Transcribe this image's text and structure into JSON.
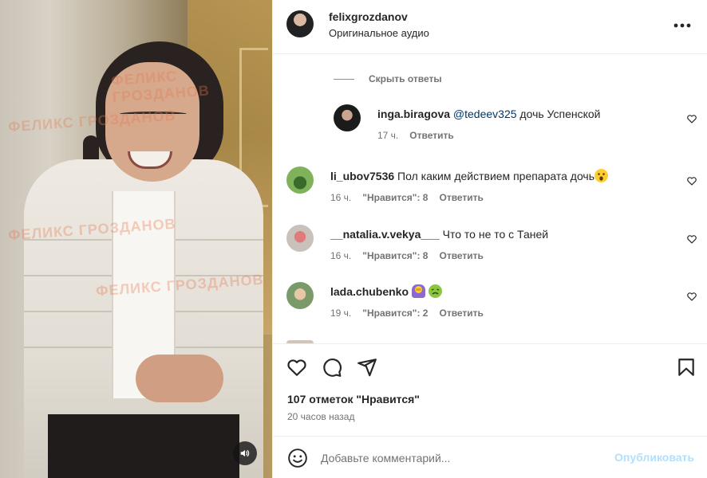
{
  "post": {
    "author": "felixgrozdanov",
    "audio": "Оригинальное аудио",
    "more_icon": "more-horizontal-icon"
  },
  "media": {
    "watermark": "ФЕЛИКС ГРОЗДАНОВ",
    "sound_icon": "speaker-icon"
  },
  "replies_toggle": "Скрыть ответы",
  "comments": [
    {
      "user": "inga.biragova",
      "mention": "@tedeev325",
      "text": "дочь Успенской",
      "time": "17 ч.",
      "likes": "",
      "reply": "Ответить"
    },
    {
      "user": "li_ubov7536",
      "mention": "",
      "text": "Пол каким действием препарата дочь",
      "emoji": [
        "astonished-face-icon"
      ],
      "time": "16 ч.",
      "likes": "\"Нравится\": 8",
      "reply": "Ответить"
    },
    {
      "user": "__natalia.v.vekya___",
      "mention": "",
      "text": "Что то не то с Таней",
      "time": "16 ч.",
      "likes": "\"Нравится\": 8",
      "reply": "Ответить"
    },
    {
      "user": "lada.chubenko",
      "mention": "",
      "text": "",
      "emoji": [
        "person-facepalming-icon",
        "nauseated-face-icon"
      ],
      "time": "19 ч.",
      "likes": "\"Нравится\": 2",
      "reply": "Ответить"
    }
  ],
  "actions": {
    "likes_count": "107 отметок \"Нравится\"",
    "posted_ago": "20 часов назад"
  },
  "composer": {
    "placeholder": "Добавьте комментарий...",
    "post_label": "Опубликовать"
  },
  "colors": {
    "link": "#00376b",
    "muted": "#737373",
    "post_disabled": "#b2dffc"
  }
}
